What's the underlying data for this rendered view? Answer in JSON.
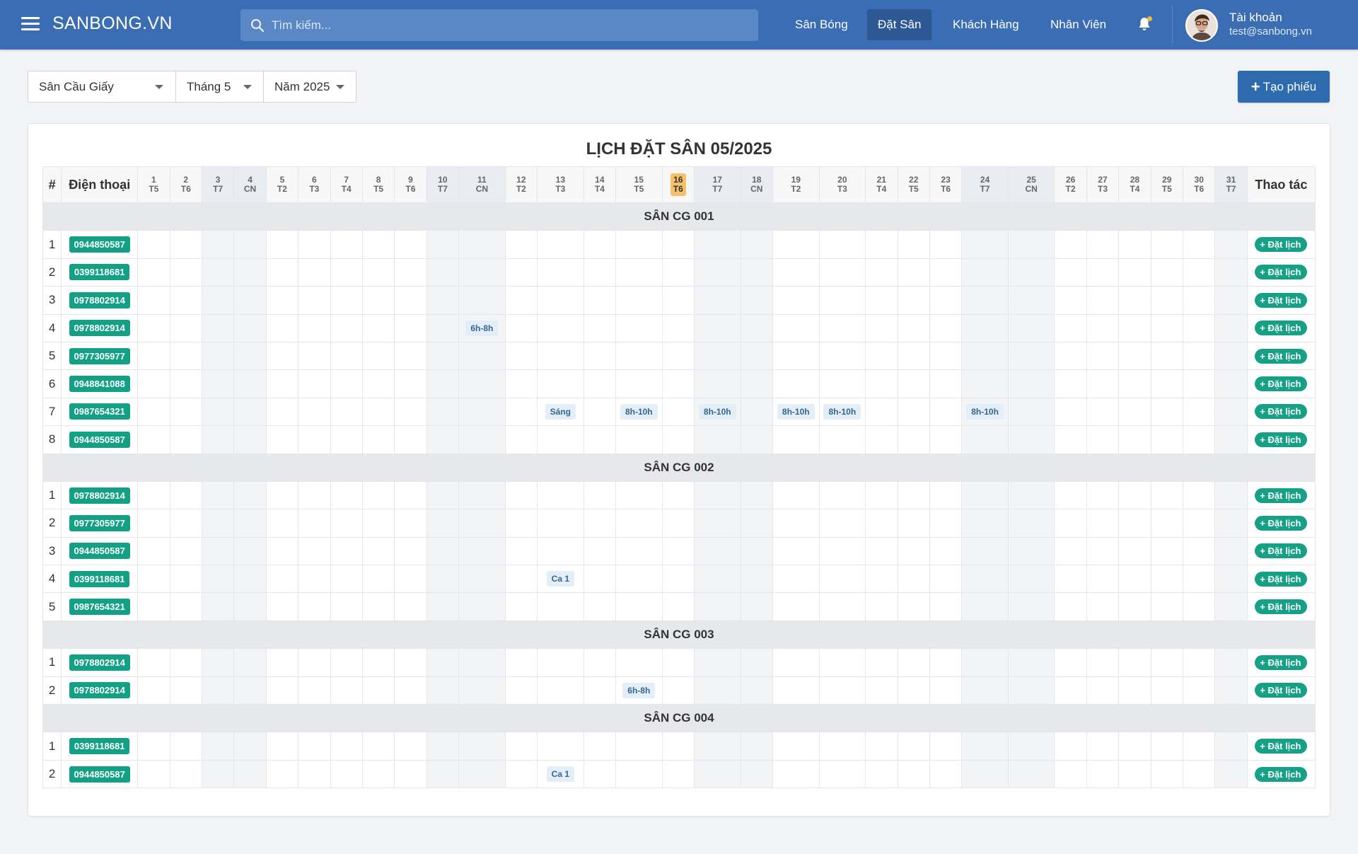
{
  "navbar": {
    "brand": "SANBONG.VN",
    "search_placeholder": "Tìm kiếm...",
    "items": [
      {
        "label": "Sân Bóng",
        "active": false
      },
      {
        "label": "Đặt Sân",
        "active": true
      },
      {
        "label": "Khách Hàng",
        "active": false
      },
      {
        "label": "Nhân Viên",
        "active": false
      }
    ],
    "account": {
      "name": "Tài khoản",
      "email": "test@sanbong.vn"
    },
    "colors": {
      "bar": "#3a6db3",
      "active": "#2d5894",
      "notification_dot": "#f5b73b"
    }
  },
  "filters": {
    "venue": "Sân Cầu Giấy",
    "month": "Tháng 5",
    "year": "Năm 2025"
  },
  "create_button": "Tạo phiếu",
  "schedule": {
    "title": "LỊCH ĐẶT SÂN 05/2025",
    "col_index": "#",
    "col_phone": "Điện thoại",
    "col_action": "Thao tác",
    "book_label": "Đặt lịch",
    "today": 16,
    "days": [
      {
        "d": "1",
        "w": "T5"
      },
      {
        "d": "2",
        "w": "T6"
      },
      {
        "d": "3",
        "w": "T7"
      },
      {
        "d": "4",
        "w": "CN"
      },
      {
        "d": "5",
        "w": "T2"
      },
      {
        "d": "6",
        "w": "T3"
      },
      {
        "d": "7",
        "w": "T4"
      },
      {
        "d": "8",
        "w": "T5"
      },
      {
        "d": "9",
        "w": "T6"
      },
      {
        "d": "10",
        "w": "T7"
      },
      {
        "d": "11",
        "w": "CN"
      },
      {
        "d": "12",
        "w": "T2"
      },
      {
        "d": "13",
        "w": "T3"
      },
      {
        "d": "14",
        "w": "T4"
      },
      {
        "d": "15",
        "w": "T5"
      },
      {
        "d": "16",
        "w": "T6"
      },
      {
        "d": "17",
        "w": "T7"
      },
      {
        "d": "18",
        "w": "CN"
      },
      {
        "d": "19",
        "w": "T2"
      },
      {
        "d": "20",
        "w": "T3"
      },
      {
        "d": "21",
        "w": "T4"
      },
      {
        "d": "22",
        "w": "T5"
      },
      {
        "d": "23",
        "w": "T6"
      },
      {
        "d": "24",
        "w": "T7"
      },
      {
        "d": "25",
        "w": "CN"
      },
      {
        "d": "26",
        "w": "T2"
      },
      {
        "d": "27",
        "w": "T3"
      },
      {
        "d": "28",
        "w": "T4"
      },
      {
        "d": "29",
        "w": "T5"
      },
      {
        "d": "30",
        "w": "T6"
      },
      {
        "d": "31",
        "w": "T7"
      }
    ],
    "sections": [
      {
        "name": "SÂN CG 001",
        "rows": [
          {
            "phone": "0944850587",
            "bookings": {}
          },
          {
            "phone": "0399118681",
            "bookings": {}
          },
          {
            "phone": "0978802914",
            "bookings": {}
          },
          {
            "phone": "0978802914",
            "bookings": {
              "11": "6h-8h"
            }
          },
          {
            "phone": "0977305977",
            "bookings": {}
          },
          {
            "phone": "0948841088",
            "bookings": {}
          },
          {
            "phone": "0987654321",
            "bookings": {
              "13": "Sáng",
              "15": "8h-10h",
              "17": "8h-10h",
              "19": "8h-10h",
              "20": "8h-10h",
              "24": "8h-10h"
            }
          },
          {
            "phone": "0944850587",
            "bookings": {}
          }
        ]
      },
      {
        "name": "SÂN CG 002",
        "rows": [
          {
            "phone": "0978802914",
            "bookings": {}
          },
          {
            "phone": "0977305977",
            "bookings": {}
          },
          {
            "phone": "0944850587",
            "bookings": {}
          },
          {
            "phone": "0399118681",
            "bookings": {
              "13": "Ca 1"
            }
          },
          {
            "phone": "0987654321",
            "bookings": {}
          }
        ]
      },
      {
        "name": "SÂN CG 003",
        "rows": [
          {
            "phone": "0978802914",
            "bookings": {}
          },
          {
            "phone": "0978802914",
            "bookings": {
              "15": "6h-8h"
            }
          }
        ]
      },
      {
        "name": "SÂN CG 004",
        "rows": [
          {
            "phone": "0399118681",
            "bookings": {}
          },
          {
            "phone": "0944850587",
            "bookings": {
              "13": "Ca 1"
            }
          }
        ]
      }
    ]
  }
}
